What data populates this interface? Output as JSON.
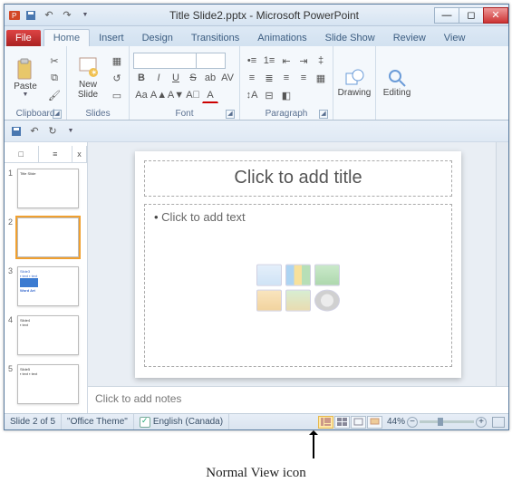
{
  "window": {
    "title": "Title Slide2.pptx - Microsoft PowerPoint"
  },
  "tabs": {
    "file": "File",
    "home": "Home",
    "insert": "Insert",
    "design": "Design",
    "transitions": "Transitions",
    "animations": "Animations",
    "slideshow": "Slide Show",
    "review": "Review",
    "view": "View"
  },
  "groups": {
    "clipboard": {
      "label": "Clipboard",
      "paste": "Paste"
    },
    "slides": {
      "label": "Slides",
      "new_slide": "New\nSlide"
    },
    "font": {
      "label": "Font"
    },
    "paragraph": {
      "label": "Paragraph"
    },
    "drawing": {
      "label": "Drawing",
      "btn": "Drawing"
    },
    "editing": {
      "label": "Editing",
      "btn": "Editing"
    }
  },
  "thumb_panel": {
    "tab_slides": "□",
    "tab_outline": "≡",
    "close": "x"
  },
  "slides": [
    {
      "num": "1"
    },
    {
      "num": "2"
    },
    {
      "num": "3"
    },
    {
      "num": "4"
    },
    {
      "num": "5"
    }
  ],
  "editor": {
    "title_placeholder": "Click to add title",
    "body_placeholder": "Click to add text",
    "notes_placeholder": "Click to add notes"
  },
  "status": {
    "slide_pos": "Slide 2 of 5",
    "theme": "\"Office Theme\"",
    "language": "English (Canada)",
    "zoom": "44%"
  },
  "callout": {
    "label": "Normal View icon"
  }
}
